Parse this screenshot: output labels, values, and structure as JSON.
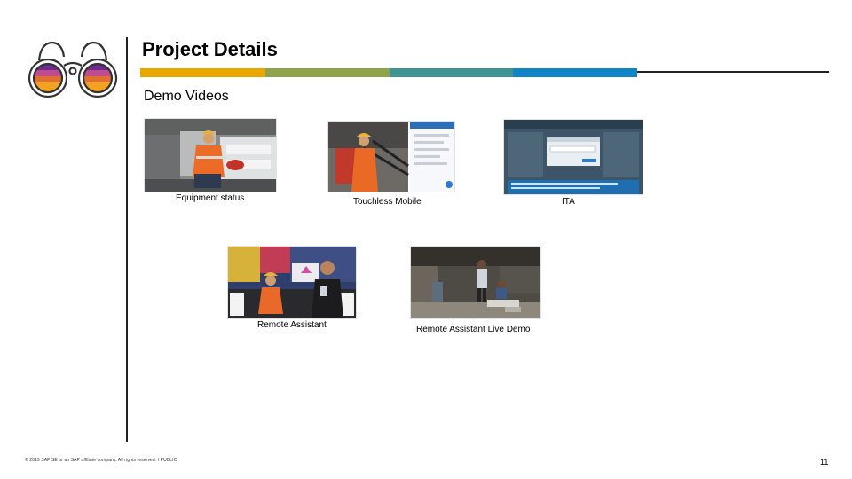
{
  "slide": {
    "title": "Project Details",
    "subtitle": "Demo Videos",
    "accent_colors": [
      "#e8a800",
      "#8fa34a",
      "#3e9393",
      "#0f85c8"
    ]
  },
  "videos": [
    {
      "caption": "Equipment status"
    },
    {
      "caption": "Touchless Mobile"
    },
    {
      "caption": "ITA"
    },
    {
      "caption": "Remote Assistant"
    },
    {
      "caption": "Remote Assistant Live Demo"
    }
  ],
  "footer": {
    "copyright": "© 2019 SAP SE or an SAP affiliate company. All rights reserved.  ǀ  PUBLIC",
    "page_number": "11"
  },
  "logo": {
    "icon": "binoculars-icon"
  }
}
